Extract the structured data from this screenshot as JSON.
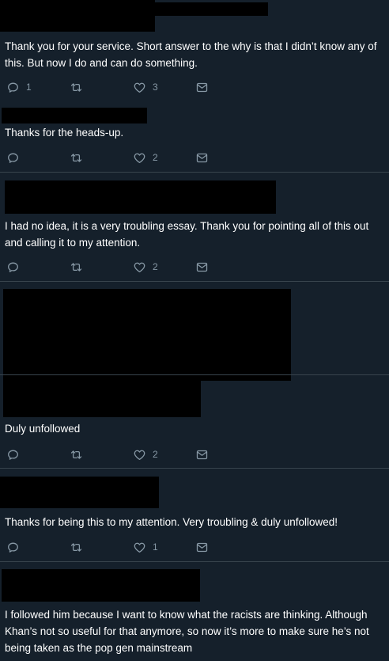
{
  "tweets": [
    {
      "text": "Thank you for your service. Short answer to the why is that I didn’t know any of this. But now I do and can do something.",
      "reply_count": "1",
      "retweet_count": "",
      "like_count": "3"
    },
    {
      "text": "Thanks for the heads-up.",
      "reply_count": "",
      "retweet_count": "",
      "like_count": "2"
    },
    {
      "text": "I had no idea, it is a very troubling essay. Thank you for pointing all of this out and calling it to my attention.",
      "reply_count": "",
      "retweet_count": "",
      "like_count": "2"
    },
    {
      "text": "Duly unfollowed",
      "reply_count": "",
      "retweet_count": "",
      "like_count": "2"
    },
    {
      "text": "Thanks for being this to my attention. Very troubling & duly unfollowed!",
      "reply_count": "",
      "retweet_count": "",
      "like_count": "1"
    },
    {
      "text": "I followed him because I want to know what the racists are thinking. Although Khan’s not so useful for that anymore, so now it’s more to make sure he’s not being taken as the pop gen mainstream",
      "reply_count": "",
      "retweet_count": "",
      "like_count": ""
    }
  ],
  "icons": {
    "reply": "reply-icon",
    "retweet": "retweet-icon",
    "like": "heart-icon",
    "dm": "envelope-icon"
  },
  "colors": {
    "background": "#15202b",
    "text": "#ffffff",
    "secondary": "#8899a6",
    "divider": "#38444d",
    "redaction": "#000000"
  }
}
